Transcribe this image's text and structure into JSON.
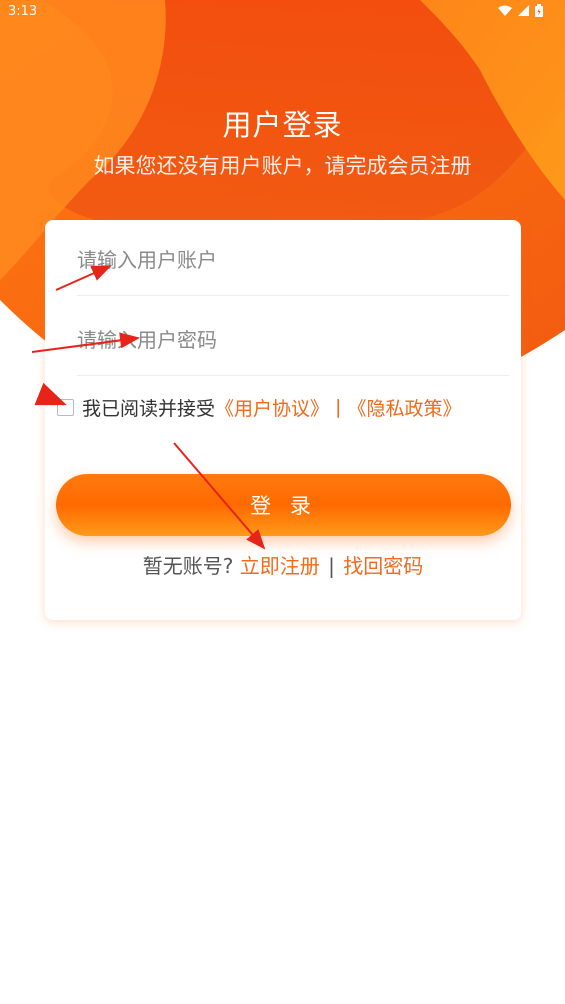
{
  "status_bar": {
    "time": "3:13",
    "icons": [
      "wifi-icon",
      "signal-icon",
      "battery-icon"
    ]
  },
  "header": {
    "title": "用户登录",
    "subtitle": "如果您还没有用户账户，请完成会员注册"
  },
  "form": {
    "username_placeholder": "请输入用户账户",
    "password_placeholder": "请输入用户密码",
    "agreement": {
      "prefix": "我已阅读并接受",
      "user_agreement": "《用户协议》",
      "separator": "|",
      "privacy_policy": "《隐私政策》",
      "checked": false
    },
    "login_button": "登 录",
    "bottom": {
      "no_account": "暂无账号?",
      "register": "立即注册",
      "divider": "|",
      "forgot_password": "找回密码"
    }
  },
  "colors": {
    "accent": "#ff6a00",
    "link": "#f26a1b",
    "annotation_arrow": "#e8231a"
  }
}
